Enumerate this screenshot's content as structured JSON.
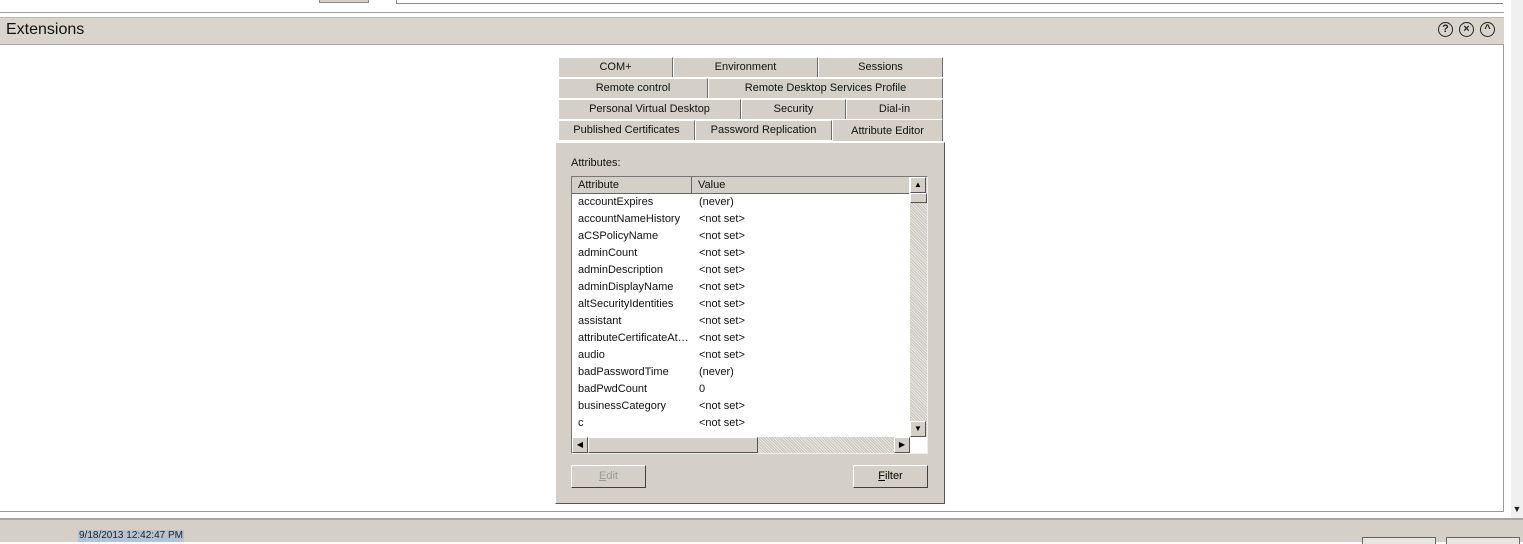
{
  "header": {
    "title": "Extensions",
    "icons": [
      "help-icon",
      "close-icon",
      "collapse-icon"
    ]
  },
  "tabs": {
    "row1": [
      "COM+",
      "Environment",
      "Sessions"
    ],
    "row2": [
      "Remote control",
      "Remote Desktop Services Profile"
    ],
    "row3": [
      "Personal Virtual Desktop",
      "Security",
      "Dial-in"
    ],
    "row4": [
      "Published Certificates",
      "Password Replication",
      "Attribute Editor"
    ],
    "active": "Attribute Editor"
  },
  "panel": {
    "attributes_label": "Attributes:",
    "columns": [
      "Attribute",
      "Value"
    ],
    "rows": [
      [
        "accountExpires",
        "(never)"
      ],
      [
        "accountNameHistory",
        "<not set>"
      ],
      [
        "aCSPolicyName",
        "<not set>"
      ],
      [
        "adminCount",
        "<not set>"
      ],
      [
        "adminDescription",
        "<not set>"
      ],
      [
        "adminDisplayName",
        "<not set>"
      ],
      [
        "altSecurityIdentities",
        "<not set>"
      ],
      [
        "assistant",
        "<not set>"
      ],
      [
        "attributeCertificateAttri...",
        "<not set>"
      ],
      [
        "audio",
        "<not set>"
      ],
      [
        "badPasswordTime",
        "(never)"
      ],
      [
        "badPwdCount",
        "0"
      ],
      [
        "businessCategory",
        "<not set>"
      ],
      [
        "c",
        "<not set>"
      ]
    ],
    "edit_label": "Edit",
    "filter_label": "Filter"
  },
  "footer": {
    "timestamp": "9/18/2013 12:42:47 PM"
  }
}
